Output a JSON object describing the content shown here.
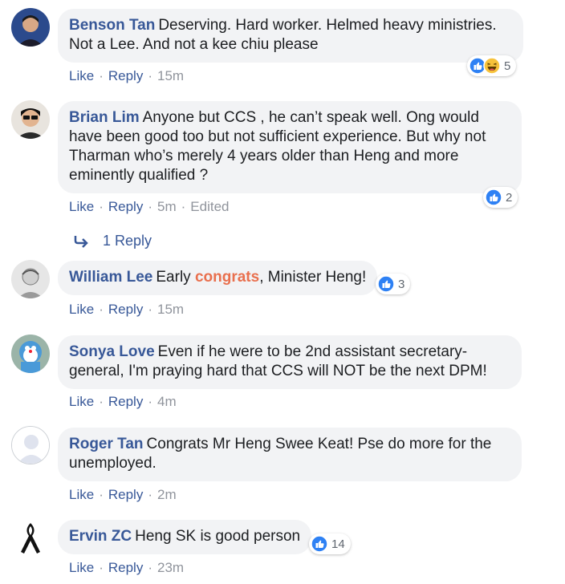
{
  "icons": {
    "like": "thumbs-up-icon",
    "haha": "haha-icon",
    "reply_arrow": "reply-arrow-icon"
  },
  "colors": {
    "author": "#385898",
    "bubble": "#f2f3f5",
    "highlight": "#e9704e",
    "like_blue": "#2e81f4"
  },
  "comments": [
    {
      "author": "Benson Tan",
      "text": "Deserving. Hard worker. Helmed heavy ministries. Not a Lee. And not a kee chiu please",
      "reactions": [
        "like",
        "haha"
      ],
      "reaction_count": "5",
      "like": "Like",
      "reply": "Reply",
      "time": "15m"
    },
    {
      "author": "Brian Lim",
      "text": "Anyone but CCS , he can’t speak well. Ong would have been good too but not sufficient experience. But why not Tharman who’s merely 4 years older than Heng and more eminently qualified ?",
      "reactions": [
        "like"
      ],
      "reaction_count": "2",
      "like": "Like",
      "reply": "Reply",
      "time": "5m",
      "edited": "Edited",
      "replies_label": "1 Reply"
    },
    {
      "author": "William Lee",
      "text_before": "Early ",
      "text_highlight": "congrats",
      "text_after": ", Minister Heng!",
      "reactions": [
        "like"
      ],
      "reaction_count": "3",
      "like": "Like",
      "reply": "Reply",
      "time": "15m"
    },
    {
      "author": "Sonya Love",
      "text": "Even if he were to be 2nd assistant secretary-general, I'm praying hard that CCS will NOT be the next DPM!",
      "like": "Like",
      "reply": "Reply",
      "time": "4m"
    },
    {
      "author": "Roger Tan",
      "text": "Congrats Mr Heng Swee Keat! Pse do more for the unemployed.",
      "like": "Like",
      "reply": "Reply",
      "time": "2m"
    },
    {
      "author": "Ervin ZC",
      "text": "Heng SK is good person",
      "reactions": [
        "like"
      ],
      "reaction_count": "14",
      "like": "Like",
      "reply": "Reply",
      "time": "23m"
    }
  ]
}
